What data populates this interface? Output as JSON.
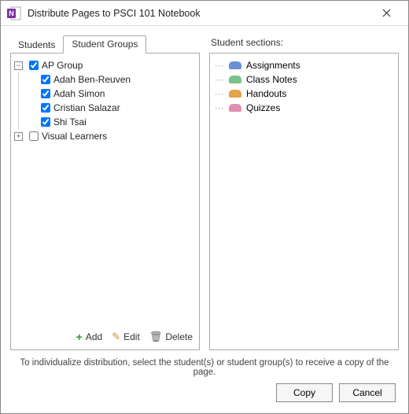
{
  "window": {
    "title": "Distribute Pages to PSCI 101 Notebook"
  },
  "tabs": {
    "students": "Students",
    "student_groups": "Student Groups",
    "active": "student_groups"
  },
  "groups_tree": {
    "group0": {
      "label": "AP Group",
      "checked": true,
      "expanded": true,
      "members": [
        {
          "label": "Adah Ben-Reuven",
          "checked": true
        },
        {
          "label": "Adah Simon",
          "checked": true
        },
        {
          "label": "Cristian Salazar",
          "checked": true
        },
        {
          "label": "Shi Tsai",
          "checked": true
        }
      ]
    },
    "group1": {
      "label": "Visual Learners",
      "checked": false,
      "expanded": false
    }
  },
  "left_actions": {
    "add": "Add",
    "edit": "Edit",
    "delete": "Delete"
  },
  "right": {
    "heading": "Student sections:",
    "sections": [
      {
        "label": "Assignments",
        "color": "#6a8fd8"
      },
      {
        "label": "Class Notes",
        "color": "#7bc28a"
      },
      {
        "label": "Handouts",
        "color": "#e6a24a"
      },
      {
        "label": "Quizzes",
        "color": "#e08fb3"
      }
    ]
  },
  "footer": {
    "help": "To individualize distribution, select the student(s) or student group(s) to receive a copy of the page."
  },
  "buttons": {
    "copy": "Copy",
    "cancel": "Cancel"
  }
}
